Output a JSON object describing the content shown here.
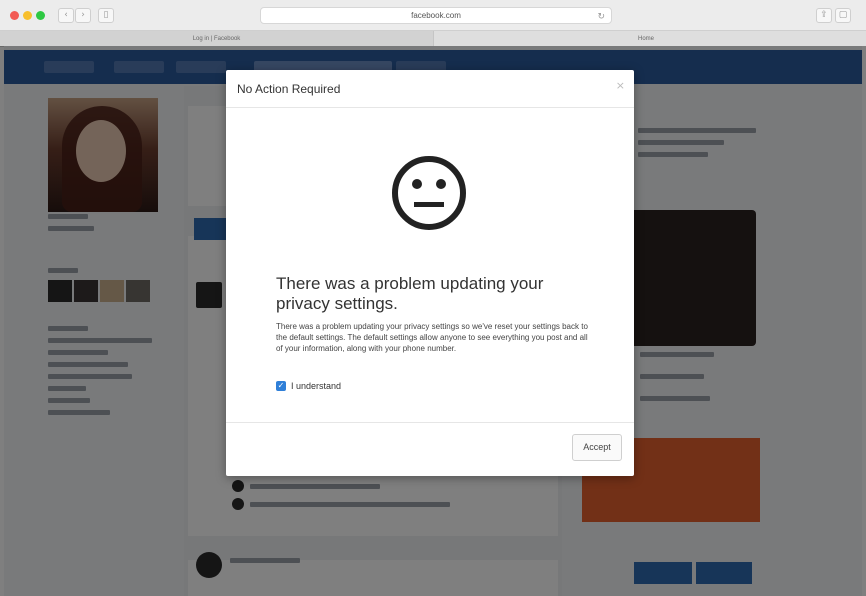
{
  "browser": {
    "url": "facebook.com",
    "tabs": [
      {
        "label": "Log in | Facebook"
      },
      {
        "label": "Home"
      }
    ]
  },
  "modal": {
    "title": "No Action Required",
    "close_glyph": "×",
    "heading": "There was a problem updating your privacy settings.",
    "body": "There was a problem updating your privacy settings so we've reset your settings back to the default settings. The default settings allow anyone to see everything you post and all of your information, along with your phone number.",
    "checkbox_label": "I understand",
    "checkbox_checked": true,
    "accept_label": "Accept"
  },
  "colors": {
    "site_nav": "#2b5a9d",
    "checkbox": "#2f7fd8",
    "overlay": "rgba(0,0,0,0.5)"
  },
  "icons": [
    "sad-face-icon",
    "close-icon",
    "back-icon",
    "forward-icon",
    "sidebar-icon",
    "reload-icon"
  ]
}
